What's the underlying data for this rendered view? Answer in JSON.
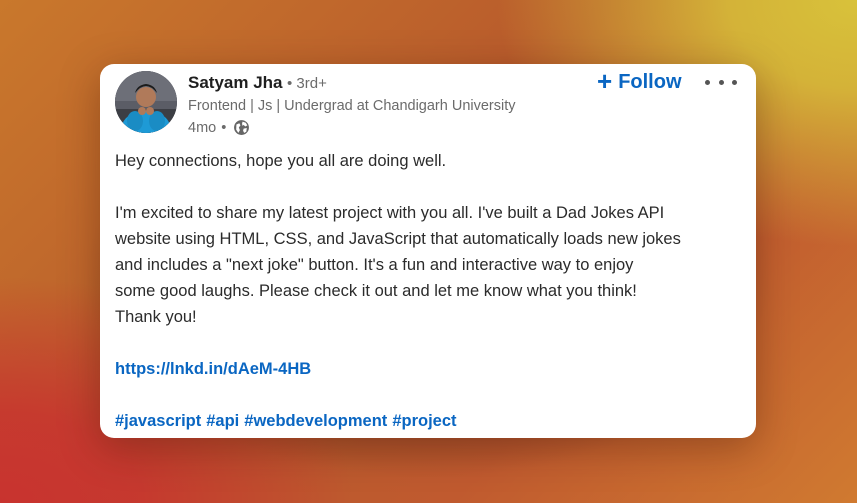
{
  "author": {
    "name": "Satyam Jha",
    "degree": "• 3rd+",
    "headline": "Frontend | Js | Undergrad at Chandigarh University",
    "time": "4mo",
    "visibility_separator": "•",
    "visibility_icon": "globe-icon"
  },
  "follow": {
    "icon": "+",
    "label": "Follow"
  },
  "more_icon": "ellipsis-icon",
  "post": {
    "greeting": "Hey connections, hope you all are doing well.",
    "paragraph_lines": [
      "I'm excited to share my latest project with you all. I've built a Dad Jokes API",
      "website using HTML, CSS, and JavaScript that automatically loads new jokes",
      "and includes a \"next joke\" button. It's a fun and interactive way to enjoy",
      "some good laughs. Please check it out and let me know what you think!",
      "Thank you!"
    ],
    "link": "https://lnkd.in/dAeM-4HB",
    "hashtags": [
      "#javascript",
      "#api",
      "#webdevelopment",
      "#project"
    ]
  },
  "colors": {
    "link_blue": "#0a66c2",
    "card_bg": "#ffffff",
    "muted_text": "#6b6b6b"
  }
}
